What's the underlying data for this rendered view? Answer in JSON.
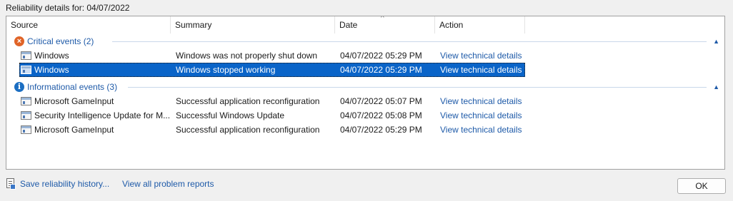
{
  "title": "Reliability details for: 04/07/2022",
  "columns": {
    "source": "Source",
    "summary": "Summary",
    "date": "Date",
    "action": "Action",
    "sort_indicator": "^"
  },
  "groups": [
    {
      "label": "Critical events (2)",
      "icon": "error-icon",
      "icon_glyph": "×",
      "rows": [
        {
          "source": "Windows",
          "summary": "Windows was not properly shut down",
          "date": "04/07/2022 05:29 PM",
          "action": "View technical details",
          "selected": false
        },
        {
          "source": "Windows",
          "summary": "Windows stopped working",
          "date": "04/07/2022 05:29 PM",
          "action": "View technical details",
          "selected": true
        }
      ]
    },
    {
      "label": "Informational events (3)",
      "icon": "info-icon",
      "icon_glyph": "i",
      "rows": [
        {
          "source": "Microsoft GameInput",
          "summary": "Successful application reconfiguration",
          "date": "04/07/2022 05:07 PM",
          "action": "View technical details",
          "selected": false
        },
        {
          "source": "Security Intelligence Update for M...",
          "summary": "Successful Windows Update",
          "date": "04/07/2022 05:08 PM",
          "action": "View technical details",
          "selected": false
        },
        {
          "source": "Microsoft GameInput",
          "summary": "Successful application reconfiguration",
          "date": "04/07/2022 05:29 PM",
          "action": "View technical details",
          "selected": false
        }
      ]
    }
  ],
  "footer": {
    "save_link": "Save reliability history...",
    "view_reports_link": "View all problem reports",
    "ok_label": "OK"
  },
  "colors": {
    "link": "#1e5aa8",
    "selection": "#0a64c8",
    "critical": "#e06428",
    "info": "#1b6ec2"
  }
}
